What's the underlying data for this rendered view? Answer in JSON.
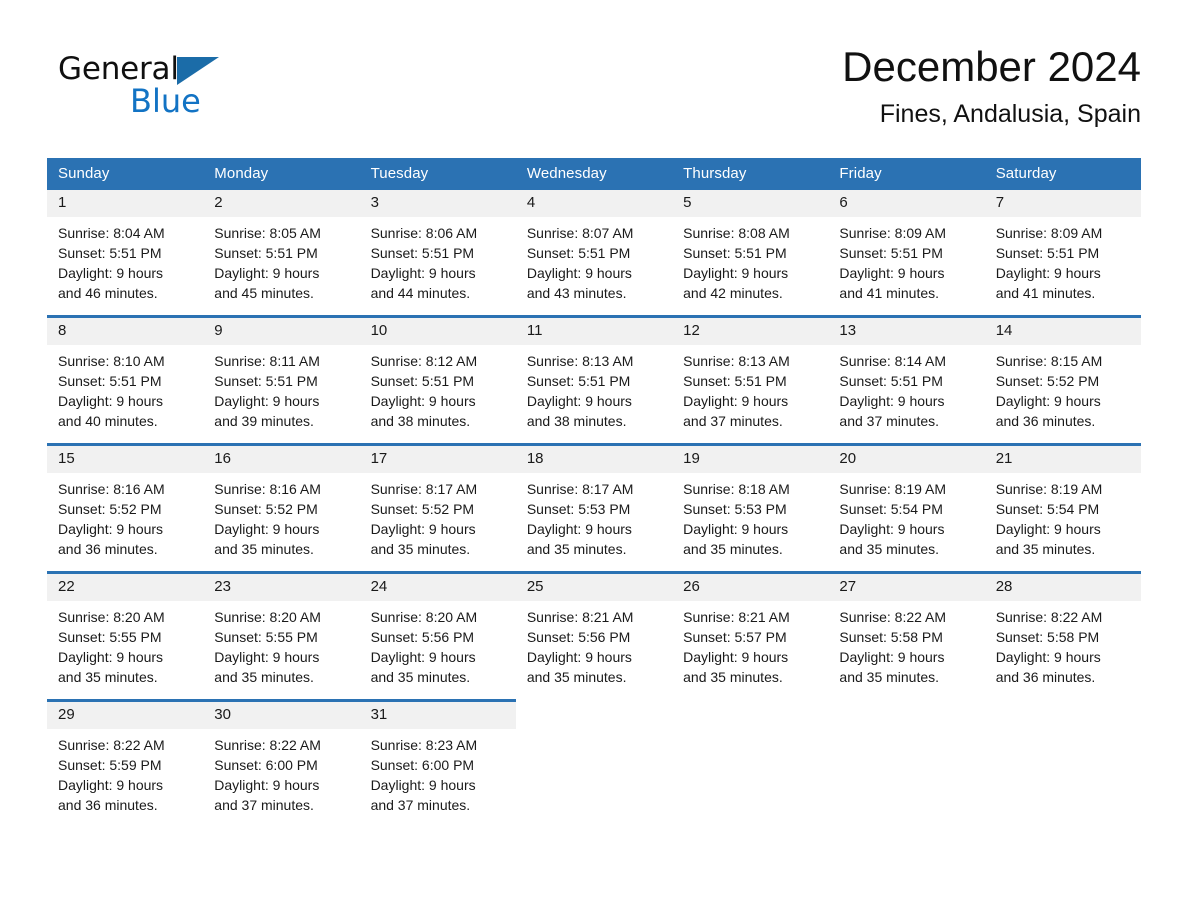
{
  "brand": {
    "name_part1": "General",
    "name_part2": "Blue",
    "triangle_icon": "triangle-icon",
    "accent_blue": "#1273c4",
    "logo_triangle_blue": "#1b6ca8"
  },
  "header": {
    "month_title": "December 2024",
    "location": "Fines, Andalusia, Spain"
  },
  "theme": {
    "header_blue": "#2b72b3",
    "row_rule_blue": "#2b72b3",
    "daynum_band": "#f1f1f1",
    "text": "#1a1a1a",
    "page_background": "#ffffff"
  },
  "weekdays": [
    "Sunday",
    "Monday",
    "Tuesday",
    "Wednesday",
    "Thursday",
    "Friday",
    "Saturday"
  ],
  "weeks": [
    {
      "days": [
        {
          "day": "1",
          "sunrise": "Sunrise: 8:04 AM",
          "sunset": "Sunset: 5:51 PM",
          "daylight_line1": "Daylight: 9 hours",
          "daylight_line2": "and 46 minutes."
        },
        {
          "day": "2",
          "sunrise": "Sunrise: 8:05 AM",
          "sunset": "Sunset: 5:51 PM",
          "daylight_line1": "Daylight: 9 hours",
          "daylight_line2": "and 45 minutes."
        },
        {
          "day": "3",
          "sunrise": "Sunrise: 8:06 AM",
          "sunset": "Sunset: 5:51 PM",
          "daylight_line1": "Daylight: 9 hours",
          "daylight_line2": "and 44 minutes."
        },
        {
          "day": "4",
          "sunrise": "Sunrise: 8:07 AM",
          "sunset": "Sunset: 5:51 PM",
          "daylight_line1": "Daylight: 9 hours",
          "daylight_line2": "and 43 minutes."
        },
        {
          "day": "5",
          "sunrise": "Sunrise: 8:08 AM",
          "sunset": "Sunset: 5:51 PM",
          "daylight_line1": "Daylight: 9 hours",
          "daylight_line2": "and 42 minutes."
        },
        {
          "day": "6",
          "sunrise": "Sunrise: 8:09 AM",
          "sunset": "Sunset: 5:51 PM",
          "daylight_line1": "Daylight: 9 hours",
          "daylight_line2": "and 41 minutes."
        },
        {
          "day": "7",
          "sunrise": "Sunrise: 8:09 AM",
          "sunset": "Sunset: 5:51 PM",
          "daylight_line1": "Daylight: 9 hours",
          "daylight_line2": "and 41 minutes."
        }
      ]
    },
    {
      "days": [
        {
          "day": "8",
          "sunrise": "Sunrise: 8:10 AM",
          "sunset": "Sunset: 5:51 PM",
          "daylight_line1": "Daylight: 9 hours",
          "daylight_line2": "and 40 minutes."
        },
        {
          "day": "9",
          "sunrise": "Sunrise: 8:11 AM",
          "sunset": "Sunset: 5:51 PM",
          "daylight_line1": "Daylight: 9 hours",
          "daylight_line2": "and 39 minutes."
        },
        {
          "day": "10",
          "sunrise": "Sunrise: 8:12 AM",
          "sunset": "Sunset: 5:51 PM",
          "daylight_line1": "Daylight: 9 hours",
          "daylight_line2": "and 38 minutes."
        },
        {
          "day": "11",
          "sunrise": "Sunrise: 8:13 AM",
          "sunset": "Sunset: 5:51 PM",
          "daylight_line1": "Daylight: 9 hours",
          "daylight_line2": "and 38 minutes."
        },
        {
          "day": "12",
          "sunrise": "Sunrise: 8:13 AM",
          "sunset": "Sunset: 5:51 PM",
          "daylight_line1": "Daylight: 9 hours",
          "daylight_line2": "and 37 minutes."
        },
        {
          "day": "13",
          "sunrise": "Sunrise: 8:14 AM",
          "sunset": "Sunset: 5:51 PM",
          "daylight_line1": "Daylight: 9 hours",
          "daylight_line2": "and 37 minutes."
        },
        {
          "day": "14",
          "sunrise": "Sunrise: 8:15 AM",
          "sunset": "Sunset: 5:52 PM",
          "daylight_line1": "Daylight: 9 hours",
          "daylight_line2": "and 36 minutes."
        }
      ]
    },
    {
      "days": [
        {
          "day": "15",
          "sunrise": "Sunrise: 8:16 AM",
          "sunset": "Sunset: 5:52 PM",
          "daylight_line1": "Daylight: 9 hours",
          "daylight_line2": "and 36 minutes."
        },
        {
          "day": "16",
          "sunrise": "Sunrise: 8:16 AM",
          "sunset": "Sunset: 5:52 PM",
          "daylight_line1": "Daylight: 9 hours",
          "daylight_line2": "and 35 minutes."
        },
        {
          "day": "17",
          "sunrise": "Sunrise: 8:17 AM",
          "sunset": "Sunset: 5:52 PM",
          "daylight_line1": "Daylight: 9 hours",
          "daylight_line2": "and 35 minutes."
        },
        {
          "day": "18",
          "sunrise": "Sunrise: 8:17 AM",
          "sunset": "Sunset: 5:53 PM",
          "daylight_line1": "Daylight: 9 hours",
          "daylight_line2": "and 35 minutes."
        },
        {
          "day": "19",
          "sunrise": "Sunrise: 8:18 AM",
          "sunset": "Sunset: 5:53 PM",
          "daylight_line1": "Daylight: 9 hours",
          "daylight_line2": "and 35 minutes."
        },
        {
          "day": "20",
          "sunrise": "Sunrise: 8:19 AM",
          "sunset": "Sunset: 5:54 PM",
          "daylight_line1": "Daylight: 9 hours",
          "daylight_line2": "and 35 minutes."
        },
        {
          "day": "21",
          "sunrise": "Sunrise: 8:19 AM",
          "sunset": "Sunset: 5:54 PM",
          "daylight_line1": "Daylight: 9 hours",
          "daylight_line2": "and 35 minutes."
        }
      ]
    },
    {
      "days": [
        {
          "day": "22",
          "sunrise": "Sunrise: 8:20 AM",
          "sunset": "Sunset: 5:55 PM",
          "daylight_line1": "Daylight: 9 hours",
          "daylight_line2": "and 35 minutes."
        },
        {
          "day": "23",
          "sunrise": "Sunrise: 8:20 AM",
          "sunset": "Sunset: 5:55 PM",
          "daylight_line1": "Daylight: 9 hours",
          "daylight_line2": "and 35 minutes."
        },
        {
          "day": "24",
          "sunrise": "Sunrise: 8:20 AM",
          "sunset": "Sunset: 5:56 PM",
          "daylight_line1": "Daylight: 9 hours",
          "daylight_line2": "and 35 minutes."
        },
        {
          "day": "25",
          "sunrise": "Sunrise: 8:21 AM",
          "sunset": "Sunset: 5:56 PM",
          "daylight_line1": "Daylight: 9 hours",
          "daylight_line2": "and 35 minutes."
        },
        {
          "day": "26",
          "sunrise": "Sunrise: 8:21 AM",
          "sunset": "Sunset: 5:57 PM",
          "daylight_line1": "Daylight: 9 hours",
          "daylight_line2": "and 35 minutes."
        },
        {
          "day": "27",
          "sunrise": "Sunrise: 8:22 AM",
          "sunset": "Sunset: 5:58 PM",
          "daylight_line1": "Daylight: 9 hours",
          "daylight_line2": "and 35 minutes."
        },
        {
          "day": "28",
          "sunrise": "Sunrise: 8:22 AM",
          "sunset": "Sunset: 5:58 PM",
          "daylight_line1": "Daylight: 9 hours",
          "daylight_line2": "and 36 minutes."
        }
      ]
    },
    {
      "days": [
        {
          "day": "29",
          "sunrise": "Sunrise: 8:22 AM",
          "sunset": "Sunset: 5:59 PM",
          "daylight_line1": "Daylight: 9 hours",
          "daylight_line2": "and 36 minutes."
        },
        {
          "day": "30",
          "sunrise": "Sunrise: 8:22 AM",
          "sunset": "Sunset: 6:00 PM",
          "daylight_line1": "Daylight: 9 hours",
          "daylight_line2": "and 37 minutes."
        },
        {
          "day": "31",
          "sunrise": "Sunrise: 8:23 AM",
          "sunset": "Sunset: 6:00 PM",
          "daylight_line1": "Daylight: 9 hours",
          "daylight_line2": "and 37 minutes."
        },
        {
          "day": "",
          "sunrise": "",
          "sunset": "",
          "daylight_line1": "",
          "daylight_line2": "",
          "empty": true
        },
        {
          "day": "",
          "sunrise": "",
          "sunset": "",
          "daylight_line1": "",
          "daylight_line2": "",
          "empty": true
        },
        {
          "day": "",
          "sunrise": "",
          "sunset": "",
          "daylight_line1": "",
          "daylight_line2": "",
          "empty": true
        },
        {
          "day": "",
          "sunrise": "",
          "sunset": "",
          "daylight_line1": "",
          "daylight_line2": "",
          "empty": true
        }
      ]
    }
  ]
}
